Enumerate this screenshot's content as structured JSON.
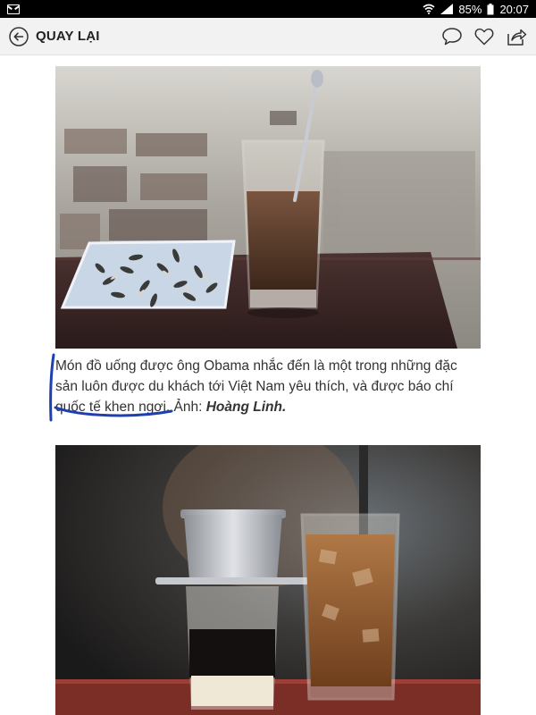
{
  "status_bar": {
    "battery": "85%",
    "time": "20:07",
    "icons": [
      "gmail-icon",
      "wifi-icon",
      "signal-icon",
      "battery-icon"
    ]
  },
  "header": {
    "back_label": "QUAY LẠI",
    "actions": [
      "comment-icon",
      "heart-icon",
      "share-icon"
    ]
  },
  "article": {
    "photo1_alt": "coffee-with-sunflower-seeds-photo",
    "caption_text": "Món đồ uống được ông Obama nhắc đến là một trong những đặc sản luôn được du khách tới Việt Nam yêu thích, và được báo chí quốc tế khen ngợi. Ảnh: ",
    "caption_author": "Hoàng Linh.",
    "photo2_alt": "vietnamese-drip-coffee-photo"
  },
  "colors": {
    "status_bar": "#000000",
    "header_bg": "#f2f2f2",
    "text": "#333333",
    "pen_highlight": "#1e3fb0"
  }
}
